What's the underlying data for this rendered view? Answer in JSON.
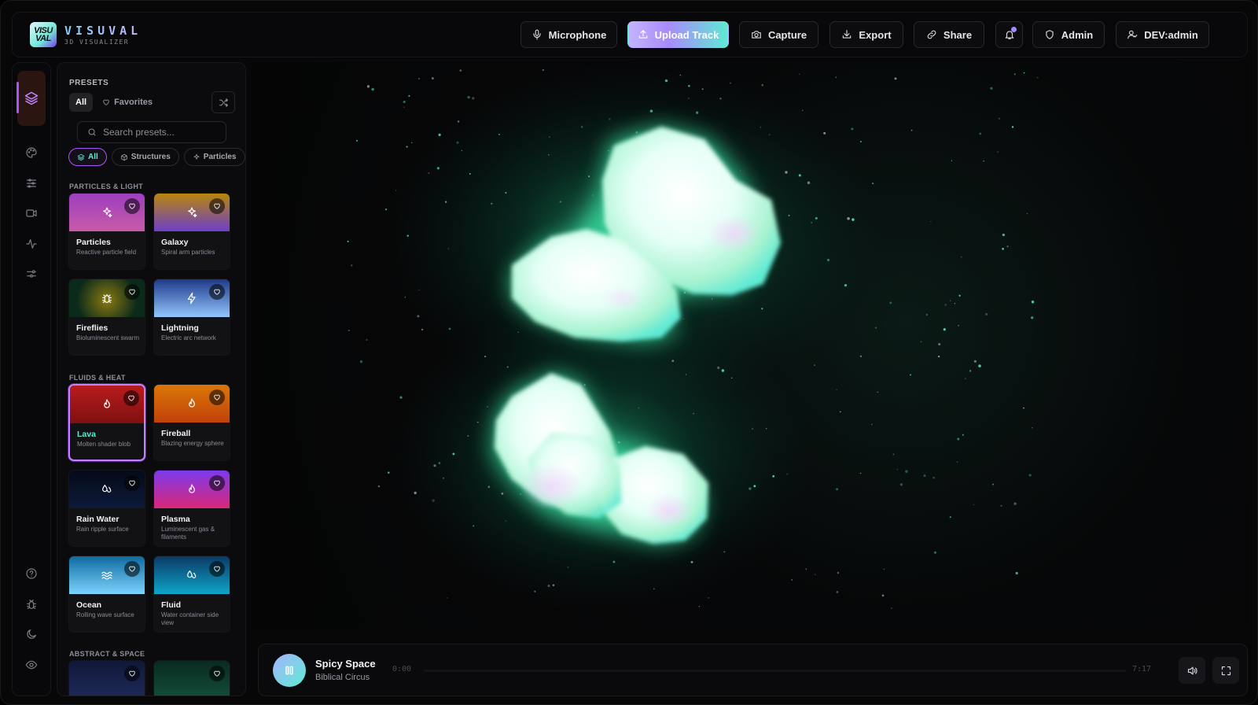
{
  "app": {
    "logo_mark": "VISU VAL",
    "title": "VISUVAL",
    "subtitle": "3D VISUALIZER"
  },
  "header": {
    "buttons": [
      {
        "label": "Microphone",
        "icon": "microphone-icon"
      },
      {
        "label": "Upload Track",
        "icon": "upload-icon"
      },
      {
        "label": "Capture",
        "icon": "camera-icon"
      },
      {
        "label": "Export",
        "icon": "download-icon"
      },
      {
        "label": "Share",
        "icon": "link-icon"
      },
      {
        "label": "",
        "icon": "bell-icon"
      },
      {
        "label": "Admin",
        "icon": "shield-icon"
      },
      {
        "label": "DEV:admin",
        "icon": "user-icon"
      }
    ]
  },
  "rail": {
    "top_icons": [
      "layers-icon",
      "palette-icon",
      "sliders-icon",
      "video-icon",
      "activity-icon",
      "settings-icon"
    ],
    "bottom_icons": [
      "help-icon",
      "bug-icon",
      "moon-icon",
      "eye-icon"
    ]
  },
  "presets": {
    "title": "PRESETS",
    "tabs": [
      "All",
      "Favorites"
    ],
    "search_placeholder": "Search presets...",
    "categories": [
      "All",
      "Structures",
      "Particles"
    ],
    "sections": [
      {
        "label": "PARTICLES & LIGHT",
        "items": [
          {
            "name": "Particles",
            "desc": "Reactive particle field",
            "icon": "sparkles-icon",
            "gradient": [
              "#9d3fc0",
              "#c85aa6"
            ]
          },
          {
            "name": "Galaxy",
            "desc": "Spiral arm particles",
            "icon": "sparkles-icon",
            "gradient": [
              "#b8860b",
              "#6d3fc9"
            ]
          },
          {
            "name": "Fireflies",
            "desc": "Bioluminescent swarm",
            "icon": "bug-icon",
            "gradient": [
              "#0a2a1a",
              "#8a7a10"
            ]
          },
          {
            "name": "Lightning",
            "desc": "Electric arc network",
            "icon": "zap-icon",
            "gradient": [
              "#1e3a8a",
              "#93c5fd"
            ]
          }
        ]
      },
      {
        "label": "FLUIDS & HEAT",
        "items": [
          {
            "name": "Lava",
            "desc": "Molten shader blob",
            "icon": "flame-icon",
            "gradient": [
              "#b91c1c",
              "#7f1010"
            ],
            "selected": true
          },
          {
            "name": "Fireball",
            "desc": "Blazing energy sphere",
            "icon": "flame-icon",
            "gradient": [
              "#d97706",
              "#c2410c"
            ]
          },
          {
            "name": "Rain Water",
            "desc": "Rain ripple surface",
            "icon": "droplets-icon",
            "gradient": [
              "#050a18",
              "#0c1a3a"
            ]
          },
          {
            "name": "Plasma",
            "desc": "Luminescent gas & filaments",
            "icon": "flame-icon",
            "gradient": [
              "#7c3aed",
              "#db2777"
            ]
          },
          {
            "name": "Ocean",
            "desc": "Rolling wave surface",
            "icon": "waves-icon",
            "gradient": [
              "#0e6aa0",
              "#7dd3fc"
            ]
          },
          {
            "name": "Fluid",
            "desc": "Water container side view",
            "icon": "droplets-icon",
            "gradient": [
              "#0b3a66",
              "#0ea5c9"
            ]
          }
        ]
      },
      {
        "label": "ABSTRACT & SPACE",
        "items": [
          {
            "name": "",
            "desc": "",
            "icon": "",
            "gradient": [
              "#101838",
              "#1e2a5a"
            ]
          },
          {
            "name": "",
            "desc": "",
            "icon": "",
            "gradient": [
              "#0a2a20",
              "#134e3a"
            ]
          }
        ]
      }
    ]
  },
  "player": {
    "title": "Spicy Space",
    "artist": "Biblical Circus",
    "current_time": "0:00",
    "total_time": "7:17",
    "progress": 0,
    "icons": [
      "pause-icon",
      "volume-icon",
      "fullscreen-icon"
    ]
  },
  "colors": {
    "accent_purple": "#a855f7",
    "accent_teal": "#5eead4",
    "glow": "#34d399"
  }
}
